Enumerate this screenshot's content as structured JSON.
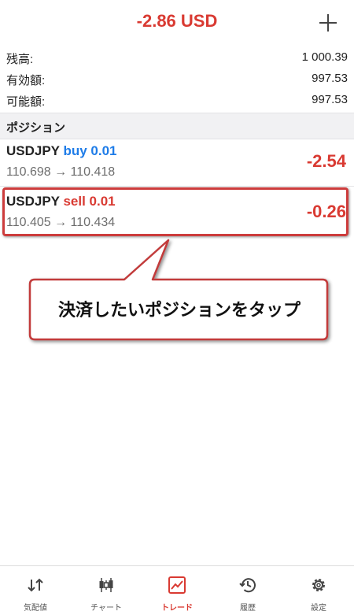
{
  "header": {
    "total_profit": "-2.86 USD",
    "add_icon": "plus-icon"
  },
  "account": [
    {
      "label": "残高:",
      "value": "1 000.39"
    },
    {
      "label": "有効額:",
      "value": "997.53"
    },
    {
      "label": "可能額:",
      "value": "997.53"
    }
  ],
  "positions": {
    "title": "ポジション",
    "items": [
      {
        "symbol": "USDJPY",
        "direction": "buy 0.01",
        "prices": "110.698 → 110.418",
        "profit": "-2.54"
      },
      {
        "symbol": "USDJPY",
        "direction": "sell 0.01",
        "prices": "110.405 → 110.434",
        "profit": "-0.26"
      }
    ]
  },
  "annotation": {
    "text": "決済したいポジションをタップ"
  },
  "colors": {
    "loss": "#d93a32",
    "buy": "#1e7ce8",
    "highlight_border": "#cd3c3c"
  },
  "tabs": [
    {
      "label": "気配値",
      "icon": "quotes-arrows-icon"
    },
    {
      "label": "チャート",
      "icon": "candlestick-chart-icon"
    },
    {
      "label": "トレード",
      "icon": "trade-chart-icon",
      "active": true
    },
    {
      "label": "履歴",
      "icon": "history-clock-icon"
    },
    {
      "label": "設定",
      "icon": "settings-gear-icon"
    }
  ]
}
